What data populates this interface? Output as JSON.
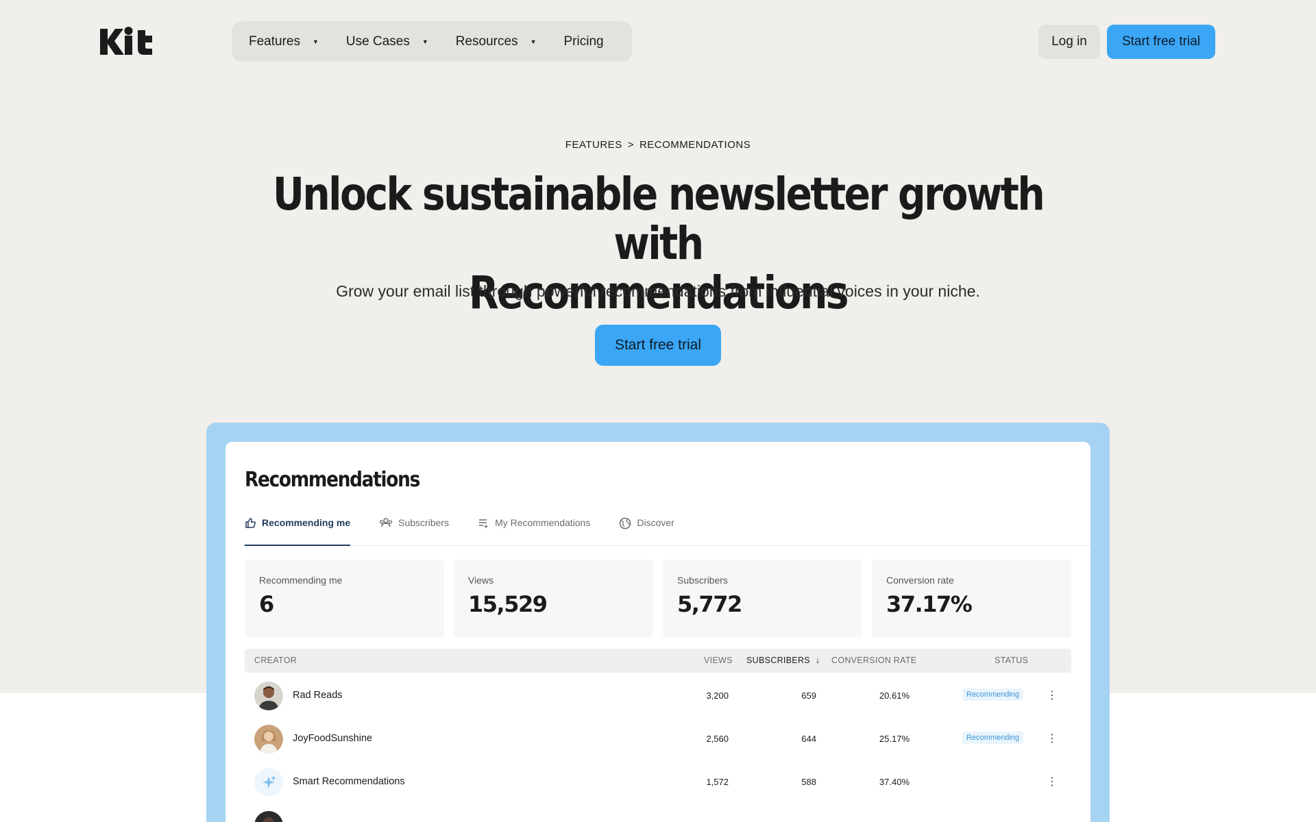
{
  "nav": {
    "logo_text": "Kit",
    "items": [
      {
        "label": "Features",
        "has_caret": true
      },
      {
        "label": "Use Cases",
        "has_caret": true
      },
      {
        "label": "Resources",
        "has_caret": true
      },
      {
        "label": "Pricing",
        "has_caret": false
      }
    ],
    "login_label": "Log in",
    "trial_label": "Start free trial"
  },
  "hero": {
    "breadcrumb": [
      "FEATURES",
      ">",
      "RECOMMENDATIONS"
    ],
    "headline_line1": "Unlock sustainable newsletter growth with",
    "headline_line2": "Recommendations",
    "subhead": "Grow your email list through powerful recommendations from influential voices in your niche.",
    "cta_label": "Start free trial"
  },
  "dashboard": {
    "title": "Recommendations",
    "tabs": [
      {
        "label": "Recommending me",
        "icon": "thumbs-up-icon",
        "active": true
      },
      {
        "label": "Subscribers",
        "icon": "users-icon",
        "active": false
      },
      {
        "label": "My Recommendations",
        "icon": "list-icon",
        "active": false
      },
      {
        "label": "Discover",
        "icon": "globe-icon",
        "active": false
      }
    ],
    "stats": [
      {
        "label": "Recommending me",
        "value": "6"
      },
      {
        "label": "Views",
        "value": "15,529"
      },
      {
        "label": "Subscribers",
        "value": "5,772"
      },
      {
        "label": "Conversion rate",
        "value": "37.17%"
      }
    ],
    "table": {
      "headers": {
        "creator": "CREATOR",
        "views": "VIEWS",
        "subscribers": "SUBSCRIBERS",
        "conversion": "CONVERSION RATE",
        "status": "STATUS"
      },
      "rows": [
        {
          "creator": "Rad Reads",
          "views": "3,200",
          "subscribers": "659",
          "conversion": "20.61%",
          "status": "Recommending"
        },
        {
          "creator": "JoyFoodSunshine",
          "views": "2,560",
          "subscribers": "644",
          "conversion": "25.17%",
          "status": "Recommending"
        },
        {
          "creator": "Smart Recommendations",
          "views": "1,572",
          "subscribers": "588",
          "conversion": "37.40%",
          "status": ""
        }
      ]
    }
  },
  "colors": {
    "accent": "#3aa6f5",
    "hero_bg": "#f0efeb",
    "frame": "#a7d3f2",
    "active_tab": "#1e3a5c"
  }
}
